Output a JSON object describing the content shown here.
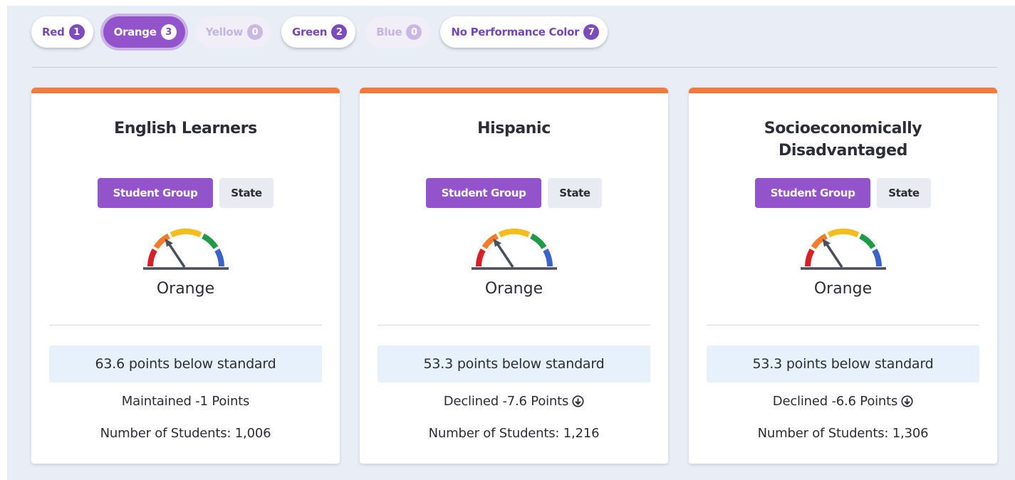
{
  "filters": [
    {
      "label": "Red",
      "count": "1",
      "state": "normal"
    },
    {
      "label": "Orange",
      "count": "3",
      "state": "active"
    },
    {
      "label": "Yellow",
      "count": "0",
      "state": "disabled"
    },
    {
      "label": "Green",
      "count": "2",
      "state": "normal"
    },
    {
      "label": "Blue",
      "count": "0",
      "state": "disabled"
    },
    {
      "label": "No Performance Color",
      "count": "7",
      "state": "normal"
    }
  ],
  "colors": {
    "accent_purple": "#9353cb",
    "card_top_orange": "#f57a3a",
    "gauge_red": "#d71f26",
    "gauge_orange": "#f47b2a",
    "gauge_yellow": "#f2bd1d",
    "gauge_green": "#1f9a47",
    "gauge_blue": "#3a62c9"
  },
  "cards": [
    {
      "title": "English Learners",
      "toggle_primary": "Student Group",
      "toggle_secondary": "State",
      "gauge_icon": "gauge-icon",
      "color_label": "Orange",
      "status": "63.6 points below standard",
      "change": "Maintained -1 Points",
      "change_icon": "",
      "students": "Number of Students: 1,006"
    },
    {
      "title": "Hispanic",
      "toggle_primary": "Student Group",
      "toggle_secondary": "State",
      "gauge_icon": "gauge-icon",
      "color_label": "Orange",
      "status": "53.3 points below standard",
      "change": "Declined -7.6 Points",
      "change_icon": "arrow-down-circle-icon",
      "students": "Number of Students: 1,216"
    },
    {
      "title": "Socioeconomically Disadvantaged",
      "toggle_primary": "Student Group",
      "toggle_secondary": "State",
      "gauge_icon": "gauge-icon",
      "color_label": "Orange",
      "status": "53.3 points below standard",
      "change": "Declined -6.6 Points",
      "change_icon": "arrow-down-circle-icon",
      "students": "Number of Students: 1,306"
    }
  ]
}
